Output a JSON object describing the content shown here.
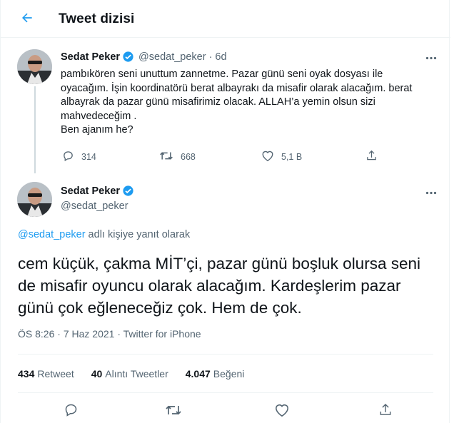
{
  "header": {
    "title": "Tweet dizisi",
    "back_icon": "arrow-left-icon"
  },
  "accent_color": "#1d9bf0",
  "author": {
    "name": "Sedat Peker",
    "handle": "@sedat_peker",
    "verified": true
  },
  "parent_tweet": {
    "time": "6d",
    "lines": [
      "pambıkören seni unuttum zannetme. Pazar günü seni oyak dosyası ile",
      "oyacağım. İşin koordinatörü berat albayrakı da misafir olarak alacağım. berat",
      "albayrak da pazar günü misafirimiz olacak. ALLAH’a yemin olsun sizi",
      "mahvedeceğim .",
      "Ben ajanım he?"
    ],
    "actions": {
      "replies": "314",
      "retweets": "668",
      "likes": "5,1 B"
    }
  },
  "main_tweet": {
    "reply_mention": "@sedat_peker",
    "reply_suffix": " adlı kişiye yanıt olarak",
    "lines": [
      "cem küçük, çakma MİT’çi, pazar günü boşluk olursa seni",
      "de misafir oyuncu olarak alacağım. Kardeşlerim pazar",
      "günü çok eğleneceğiz çok. Hem de çok."
    ],
    "time": "ÖS 8:26",
    "separator": " · ",
    "date": "7 Haz 2021",
    "source": "Twitter for iPhone"
  },
  "stats": {
    "retweets_count": "434",
    "retweets_label": "Retweet",
    "quotes_count": "40",
    "quotes_label": "Alıntı Tweetler",
    "likes_count": "4.047",
    "likes_label": "Beğeni"
  }
}
